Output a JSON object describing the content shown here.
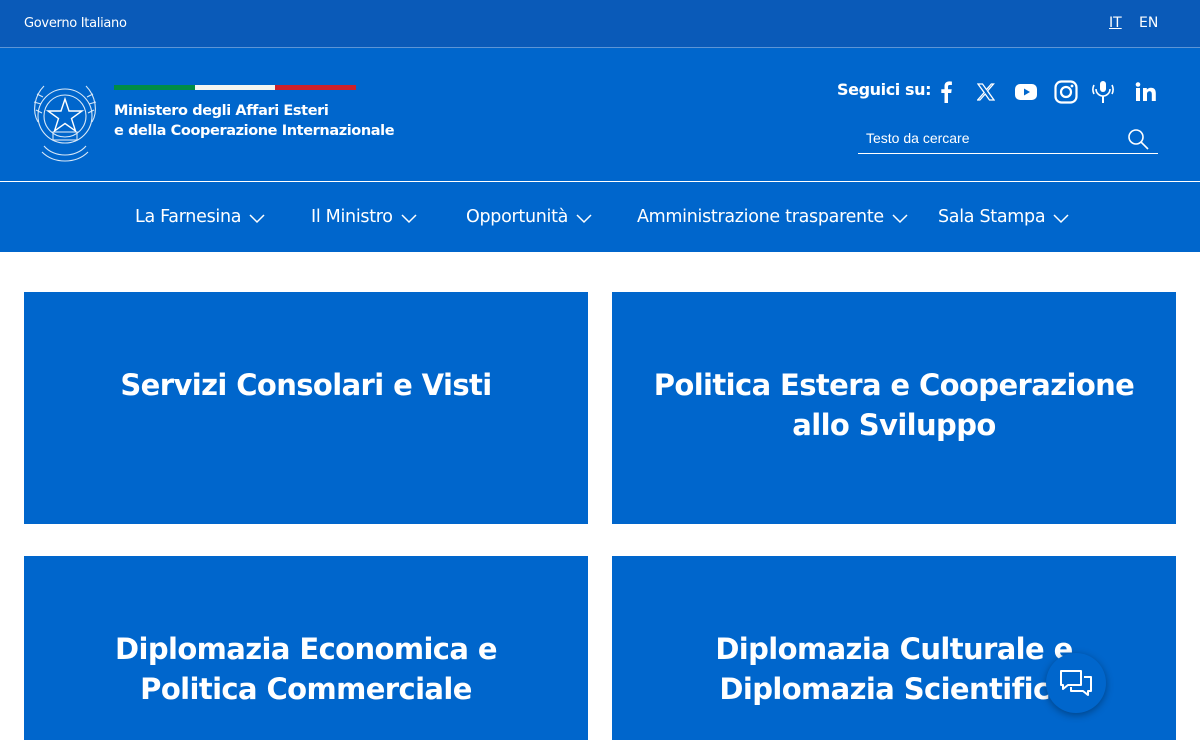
{
  "topbar": {
    "government_label": "Governo Italiano",
    "languages": [
      "IT",
      "EN"
    ]
  },
  "header": {
    "ministry_line1": "Ministero degli Affari Esteri",
    "ministry_line2": "e della Cooperazione Internazionale",
    "flag_colors": [
      "#008c45",
      "#f4f5f0",
      "#cd212a"
    ],
    "follow_label": "Seguici su:",
    "social_icons": [
      "facebook-icon",
      "x-icon",
      "youtube-icon",
      "instagram-icon",
      "podcast-icon",
      "linkedin-icon"
    ],
    "search_placeholder": "Testo da cercare"
  },
  "nav": {
    "items": [
      {
        "label": "La Farnesina"
      },
      {
        "label": "Il Ministro"
      },
      {
        "label": "Opportunità"
      },
      {
        "label": "Amministrazione trasparente"
      },
      {
        "label": "Sala Stampa"
      }
    ]
  },
  "cards": [
    {
      "line1": "Servizi Consolari e Visti",
      "line2": ""
    },
    {
      "line1": "Politica Estera e Cooperazione",
      "line2": "allo Sviluppo"
    },
    {
      "line1": "Diplomazia Economica e",
      "line2": "Politica Commerciale"
    },
    {
      "line1": "Diplomazia Culturale e",
      "line2": "Diplomazia Scientifica"
    }
  ],
  "colors": {
    "primary_blue": "#0066cc",
    "topbar_blue": "#0a5ab8"
  },
  "chat_icon": "chat-icon"
}
